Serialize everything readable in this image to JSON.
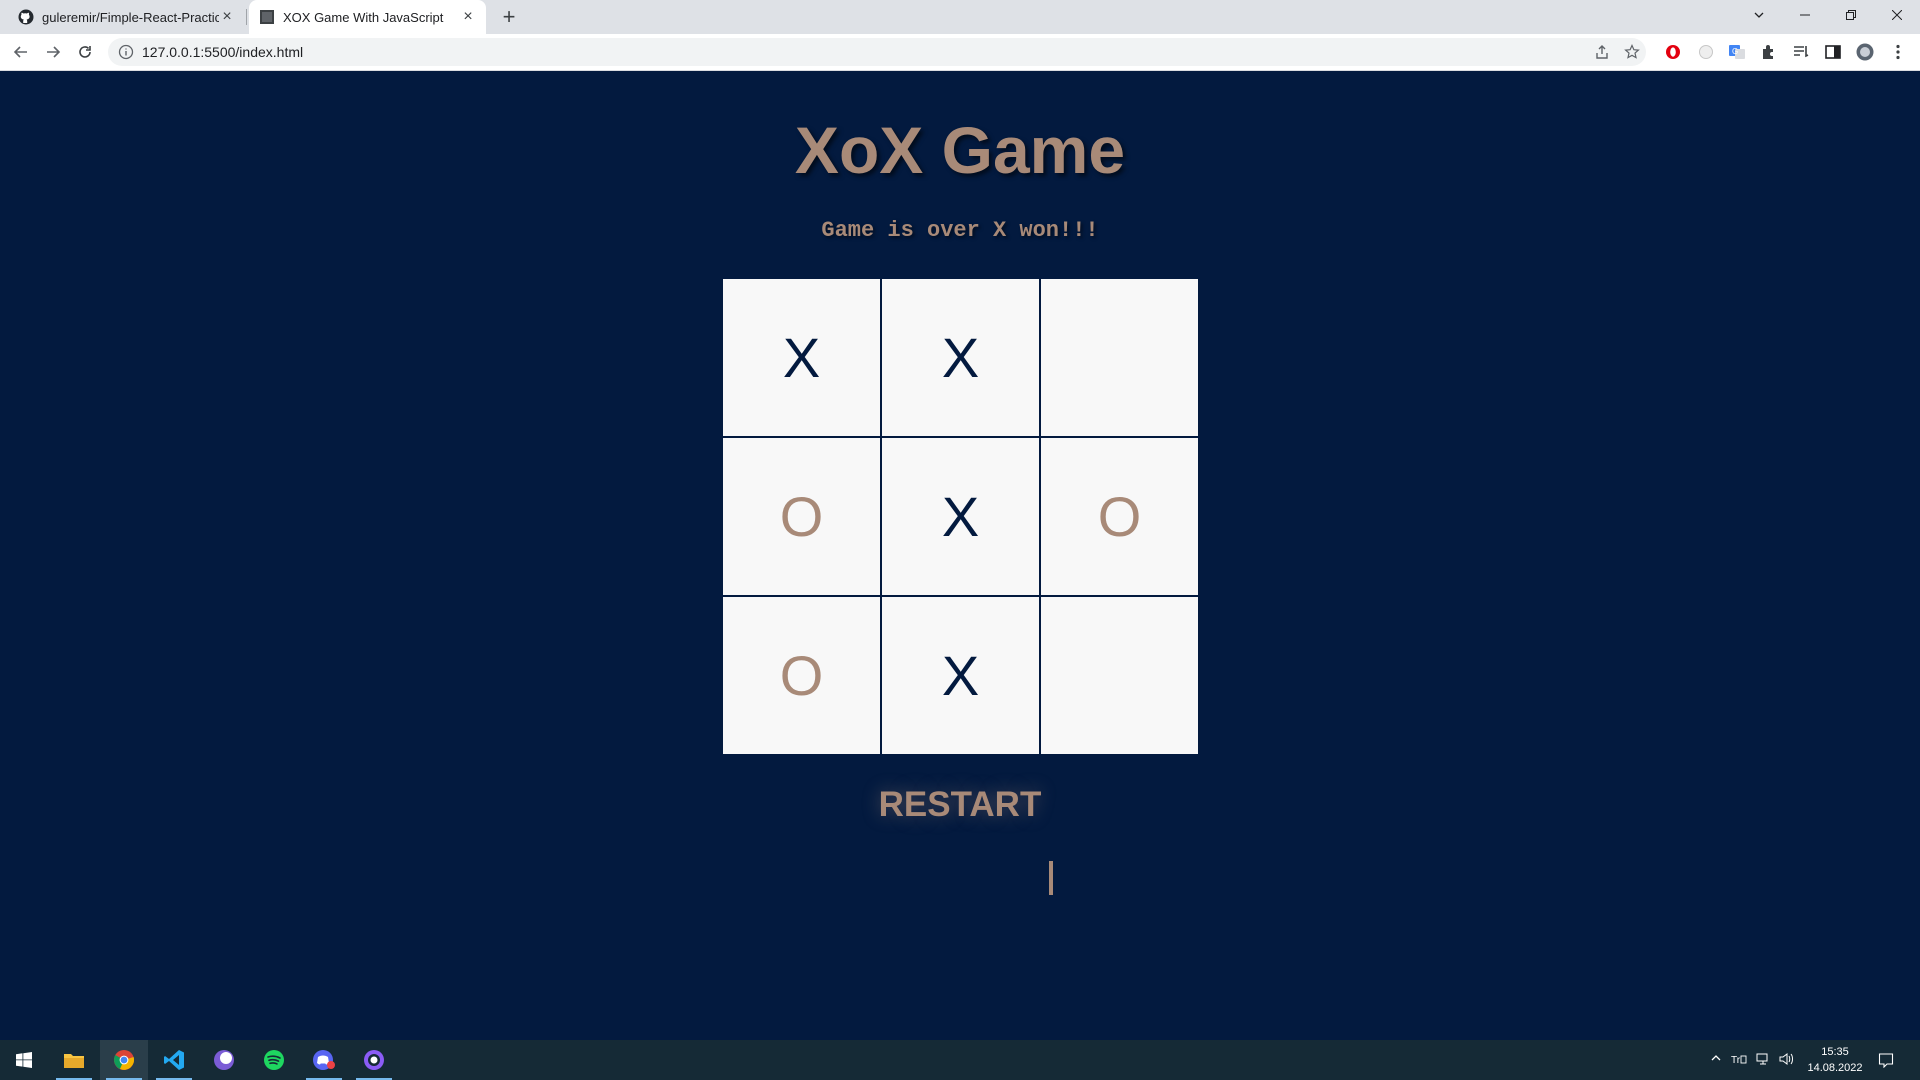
{
  "browser": {
    "tabs": [
      {
        "title": "guleremir/Fimple-React-Practicum",
        "favicon": "github-icon",
        "active": false
      },
      {
        "title": "XOX Game With JavaScript",
        "favicon": "page-icon",
        "active": true
      }
    ],
    "url": "127.0.0.1:5500/index.html",
    "new_tab_icon": "plus-icon"
  },
  "game": {
    "title": "XoX Game",
    "status": "Game is over X won!!!",
    "board": [
      "X",
      "X",
      "",
      "O",
      "X",
      "O",
      "O",
      "X",
      ""
    ],
    "restart_label": "RESTART"
  },
  "taskbar": {
    "apps": [
      "windows-start-icon",
      "file-explorer-icon",
      "chrome-icon",
      "vscode-icon",
      "browser-icon",
      "spotify-icon",
      "discord-icon",
      "github-desktop-icon"
    ],
    "clock": {
      "time": "15:35",
      "date": "14.08.2022"
    }
  },
  "colors": {
    "background": "#031a3f",
    "accent": "#a88a78",
    "cell": "#f8f8f8",
    "x_mark": "#031a3f"
  }
}
